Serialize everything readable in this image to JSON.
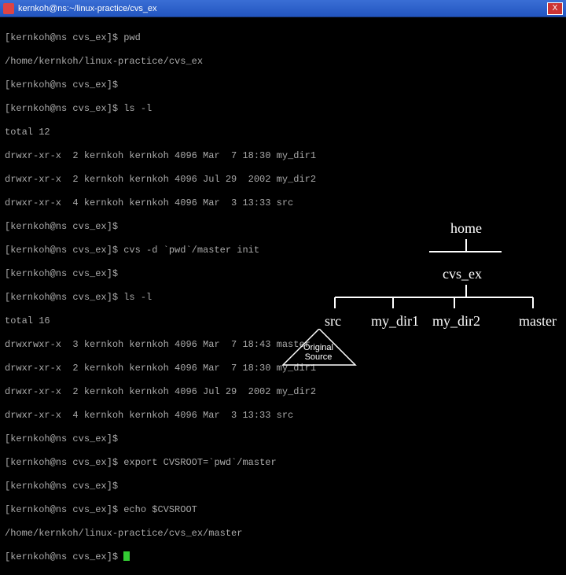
{
  "titlebar": {
    "title": "kernkoh@ns:~/linux-practice/cvs_ex",
    "close": "X"
  },
  "prompt": {
    "user_host": "[kernkoh@ns",
    "dir": " cvs_ex]",
    "dollar": "$ "
  },
  "cmds": {
    "pwd": "pwd",
    "pwd_out": "/home/kernkoh/linux-practice/cvs_ex",
    "empty": "",
    "lsl": "ls -l",
    "total12": "total 12",
    "l1a": "drwxr-xr-x  2 kernkoh kernkoh 4096 Mar  7 18:30 my_dir1",
    "l1b": "drwxr-xr-x  2 kernkoh kernkoh 4096 Jul 29  2002 my_dir2",
    "l1c": "drwxr-xr-x  4 kernkoh kernkoh 4096 Mar  3 13:33 src",
    "cvsinit": "cvs -d `pwd`/master init",
    "total16": "total 16",
    "l2a": "drwxrwxr-x  3 kernkoh kernkoh 4096 Mar  7 18:43 master",
    "l2b": "drwxr-xr-x  2 kernkoh kernkoh 4096 Mar  7 18:30 my_dir1",
    "l2c": "drwxr-xr-x  2 kernkoh kernkoh 4096 Jul 29  2002 my_dir2",
    "l2d": "drwxr-xr-x  4 kernkoh kernkoh 4096 Mar  3 13:33 src",
    "export": "export CVSROOT=`pwd`/master",
    "echo": "echo $CVSROOT",
    "echo_out": "/home/kernkoh/linux-practice/cvs_ex/master"
  },
  "tree": {
    "home": "home",
    "cvsex": "cvs_ex",
    "src": "src",
    "mydir1": "my_dir1",
    "mydir2": "my_dir2",
    "master": "master"
  },
  "annotation": {
    "original1": "Original",
    "original2": "Source"
  }
}
